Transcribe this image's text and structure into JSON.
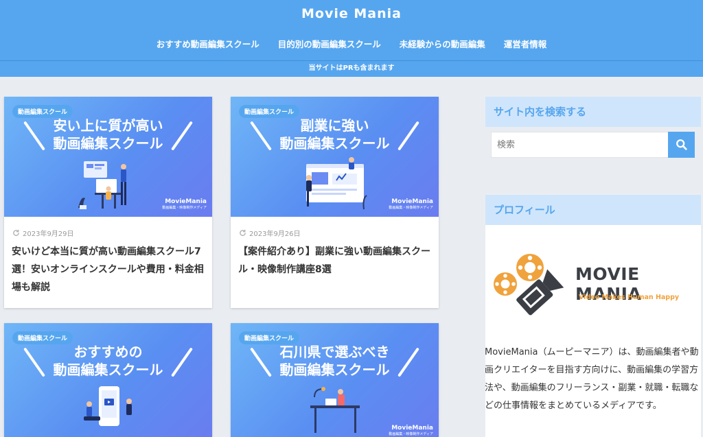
{
  "header": {
    "site_title": "Movie Mania",
    "nav": [
      "おすすめ動画編集スクール",
      "目的別の動画編集スクール",
      "未経験からの動画編集",
      "運営者情報"
    ],
    "notice": "当サイトはPRも含まれます"
  },
  "posts": [
    {
      "badge": "動画編集スクール",
      "thumb_line1": "安い上に質が高い",
      "thumb_line2": "動画編集スクール",
      "watermark": "MovieMania",
      "watermark_sub": "動画編集・映像制作メディア",
      "date": "2023年9月29日",
      "title": "安いけど本当に質が高い動画編集スクール7選！安いオンラインスクールや費用・料金相場も解説"
    },
    {
      "badge": "動画編集スクール",
      "thumb_line1": "副業に強い",
      "thumb_line2": "動画編集スクール",
      "watermark": "MovieMania",
      "watermark_sub": "動画編集・映像制作メディア",
      "date": "2023年9月26日",
      "title": "【案件紹介あり】副業に強い動画編集スクール・映像制作講座8選"
    },
    {
      "badge": "動画編集スクール",
      "thumb_line1": "おすすめの",
      "thumb_line2": "動画編集スクール",
      "watermark": "MovieMania",
      "watermark_sub": "動画編集・映像制作メディア"
    },
    {
      "badge": "動画編集スクール",
      "thumb_line1": "石川県で選ぶべき",
      "thumb_line2": "動画編集スクール",
      "watermark": "MovieMania",
      "watermark_sub": "動画編集・映像制作メディア"
    }
  ],
  "sidebar": {
    "search_title": "サイト内を検索する",
    "search_placeholder": "検索",
    "profile_title": "プロフィール",
    "logo_text": "MOVIE MANIA",
    "logo_tagline": "Video Makes Human Happy",
    "profile_desc": "MovieMania（ムーピーマニア）は、動画編集者や動画クリエイターを目指す方向けに、動画編集の学習方法や、動画編集のフリーランス・副業・就職・転職などの仕事情報をまとめているメディアです。"
  },
  "colors": {
    "primary": "#56a6ef",
    "widget_head_bg": "#cfe5fb",
    "logo_accent": "#f0a23c",
    "logo_dark": "#3b3f45"
  }
}
